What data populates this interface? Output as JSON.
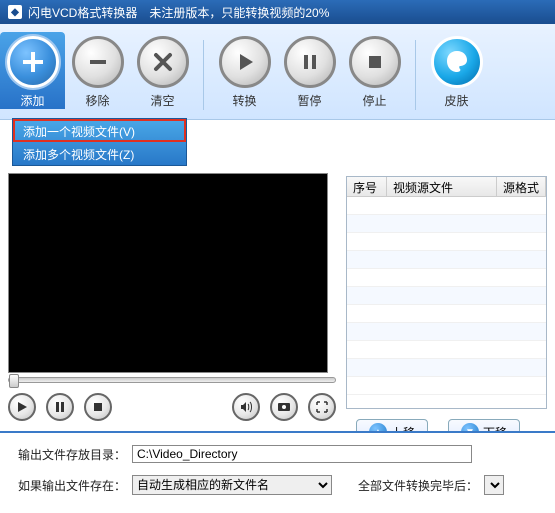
{
  "titlebar": {
    "app_name": "闪电VCD格式转换器",
    "version_note": "未注册版本，只能转换视频的20%"
  },
  "toolbar": {
    "add": "添加",
    "remove": "移除",
    "clear": "清空",
    "convert": "转换",
    "pause": "暂停",
    "stop": "停止",
    "skin": "皮肤"
  },
  "dropdown": {
    "add_one": "添加一个视频文件(V)",
    "add_many": "添加多个视频文件(Z)"
  },
  "table": {
    "headers": {
      "index": "序号",
      "source": "视频源文件",
      "format": "源格式"
    }
  },
  "right_buttons": {
    "move_up": "上移",
    "move_down": "下移"
  },
  "bottom_form": {
    "output_dir_label": "输出文件存放目录：",
    "output_dir_value": "C:\\Video_Directory",
    "output_name_label": "如果输出文件存在：",
    "output_name_value": "自动生成相应的新文件名",
    "after_done_label": "全部文件转换完毕后："
  }
}
